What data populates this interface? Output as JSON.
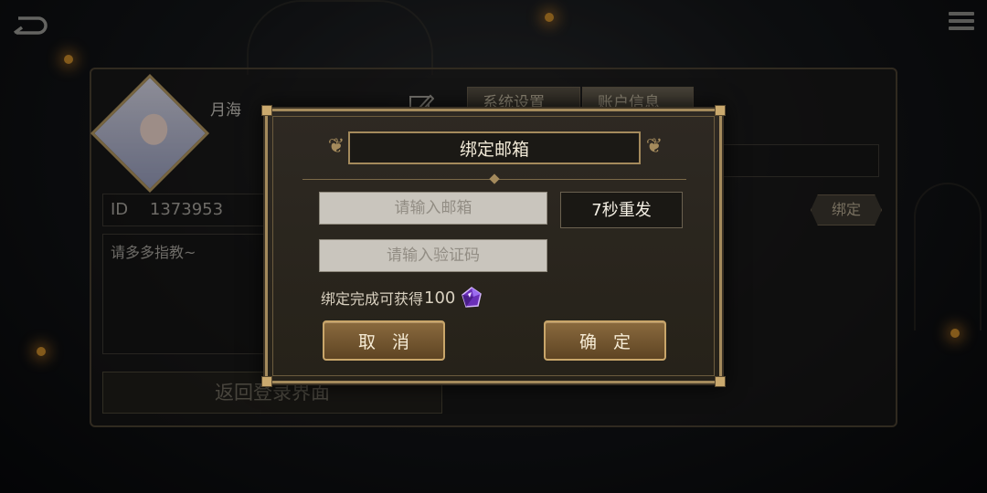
{
  "background_panel": {
    "nickname": "月海",
    "tabs": [
      "系统设置",
      "账户信息"
    ],
    "id_label": "ID",
    "id_value": "1373953",
    "signature": "请多多指教~",
    "return_login": "返回登录界面",
    "bind_button": "绑定"
  },
  "modal": {
    "title": "绑定邮箱",
    "email_placeholder": "请输入邮箱",
    "code_placeholder": "请输入验证码",
    "resend_label": "7秒重发",
    "reward_text": "绑定完成可获得",
    "reward_amount": "100",
    "reward_icon": "purple-gem-icon",
    "cancel_label": "取消",
    "confirm_label": "确定"
  },
  "colors": {
    "accent_gold": "#a48a5c",
    "button_brown": "#7a5a30",
    "gem_purple": "#8a4fd8"
  }
}
